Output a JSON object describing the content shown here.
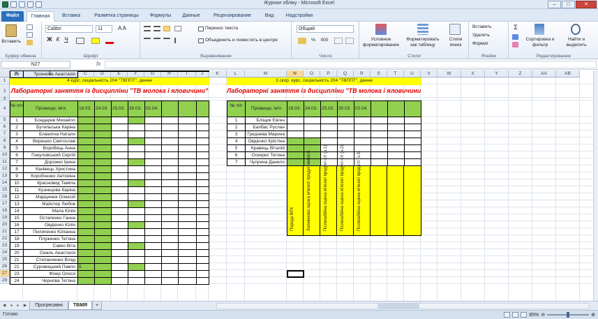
{
  "window": {
    "title": "Журнал обліку - Microsoft Excel",
    "minimize": "–",
    "maximize": "□",
    "close": "✕"
  },
  "tabs": [
    "Файл",
    "Главная",
    "Вставка",
    "Разметка страницы",
    "Формулы",
    "Данные",
    "Рецензирование",
    "Вид",
    "Надстройки"
  ],
  "ribbon": {
    "clipboard": {
      "paste": "Вставить",
      "label": "Буфер обмена"
    },
    "font": {
      "name": "Calibri",
      "size": "11",
      "bold": "Ж",
      "italic": "К",
      "underline": "Ч",
      "label": "Шрифт"
    },
    "alignment": {
      "wrap": "Перенос текста",
      "merge": "Объединить и поместить в центре",
      "label": "Выравнивание"
    },
    "number": {
      "format": "Общий",
      "percent": "%",
      "thousands": "000",
      "label": "Число"
    },
    "styles": {
      "conditional": "Условное форматирование",
      "as_table": "Форматировать как таблицу",
      "cell_styles": "Стили ячеек",
      "label": "Стили"
    },
    "cells": {
      "insert": "Вставить",
      "delete": "Удалить",
      "format": "Формат",
      "label": "Ячейки"
    },
    "editing": {
      "sum": "Σ",
      "sort": "Сортировка и фильтр",
      "find": "Найти и выделить",
      "label": "Редактирование"
    }
  },
  "formula_bar": {
    "name_box": "N27",
    "fx": "fx",
    "value": ""
  },
  "columns": [
    "A",
    "B",
    "C",
    "D",
    "E",
    "F",
    "G",
    "H",
    "I",
    "J",
    "K",
    "L",
    "M",
    "N",
    "O",
    "P",
    "Q",
    "R",
    "S",
    "T",
    "U",
    "V",
    "W",
    "X",
    "Y",
    "Z",
    "AA",
    "AB"
  ],
  "selected_column": "N",
  "selected_row": "27",
  "rows": [
    "1",
    "2",
    "3",
    "4",
    "5",
    "6",
    "7",
    "8",
    "9",
    "10",
    "11",
    "12",
    "13",
    "14",
    "15",
    "16",
    "17",
    "18",
    "19",
    "20",
    "21",
    "22",
    "23",
    "24",
    "25",
    "26",
    "27",
    "28"
  ],
  "left_table": {
    "banner": "4 курс, сеціальність 204 \"ТВППТ\", денне",
    "title": "Лабораторні заняття із дисципліни \"ТВ молока і яловичини\"",
    "col_num": "№ п/п",
    "col_name": "Прізвище, ім'я",
    "dates": [
      "18.03.",
      "24.03.",
      "25.03.",
      "30.03.",
      "02.04."
    ],
    "students": [
      {
        "n": "1",
        "name": "Бондарев Михайло"
      },
      {
        "n": "2",
        "name": "Бутильська Каріна"
      },
      {
        "n": "3",
        "name": "Блакитна Наталя"
      },
      {
        "n": "4",
        "name": "Верешко Святослав"
      },
      {
        "n": "5",
        "name": "Воробець Анна"
      },
      {
        "n": "6",
        "name": "Гожуловський Сергій"
      },
      {
        "n": "7",
        "name": "Дорожко Ірина"
      },
      {
        "n": "8",
        "name": "Канівець Христина"
      },
      {
        "n": "9",
        "name": "Коробченко Антоніна"
      },
      {
        "n": "10",
        "name": "Красновид Таміла"
      },
      {
        "n": "11",
        "name": "Кузнецова Каріна"
      },
      {
        "n": "12",
        "name": "Марцинюк Олексій"
      },
      {
        "n": "13",
        "name": "Майстер Любов"
      },
      {
        "n": "14",
        "name": "Мала Юлія"
      },
      {
        "n": "15",
        "name": "Остапенко Ганна"
      },
      {
        "n": "16",
        "name": "Овдієнко Юлія"
      },
      {
        "n": "17",
        "name": "Пилипенко Юліанна"
      },
      {
        "n": "18",
        "name": "Плуженко Тетяна"
      },
      {
        "n": "19",
        "name": "Савко Віта"
      },
      {
        "n": "20",
        "name": "Смаль Анастасія"
      },
      {
        "n": "21",
        "name": "Степанченко Влад"
      },
      {
        "n": "22",
        "name": "Суровицький Павло",
        "c18": "5"
      },
      {
        "n": "23",
        "name": "Фізер Олеся"
      },
      {
        "n": "24",
        "name": "Чернова Тетяна"
      },
      {
        "n": "25",
        "name": "Троянова Анастасія"
      }
    ]
  },
  "right_table": {
    "banner": "3 скор. курс, сеціальність 204 \"ТВППТ\", денне",
    "title": "Лабораторні заняття із дисципліни \"ТВ молока і яловичини\"",
    "col_num": "№ п/п",
    "col_name": "Прізвище, ім'я",
    "dates": [
      "18.03.",
      "24.03.",
      "25.03.",
      "30.03.",
      "02.04."
    ],
    "students": [
      {
        "n": "1",
        "name": "Бліщик Євген"
      },
      {
        "n": "2",
        "name": "Балбас Руслан"
      },
      {
        "n": "3",
        "name": "Греднева Марина"
      },
      {
        "n": "4",
        "name": "Овдієнко Крістіна"
      },
      {
        "n": "5",
        "name": "Кравець Віталій"
      },
      {
        "n": "6",
        "name": "Оскирко Тетяна"
      },
      {
        "n": "7",
        "name": "Чуприна Данило"
      }
    ],
    "vertical_labels": [
      "Порода ВРХ",
      "Залежнова оцінка м'ясної продуктивності",
      "Післязабійна оцінка м'ясної продукт-сті (ч.1)",
      "Післязабійна оцінка м'ясної продукт-сті (ч.2)",
      "Післязабійна оцінка м'ясної прод-сті (ч.3)"
    ]
  },
  "sheets": [
    "Прогресивні",
    "ТВМЯ"
  ],
  "active_sheet": "ТВМЯ",
  "status": "Готово",
  "zoom": "85%",
  "colors": {
    "green": "#92d050",
    "yellow": "#ffff00",
    "red_title": "#e00000",
    "selection": "#f8d99c"
  }
}
